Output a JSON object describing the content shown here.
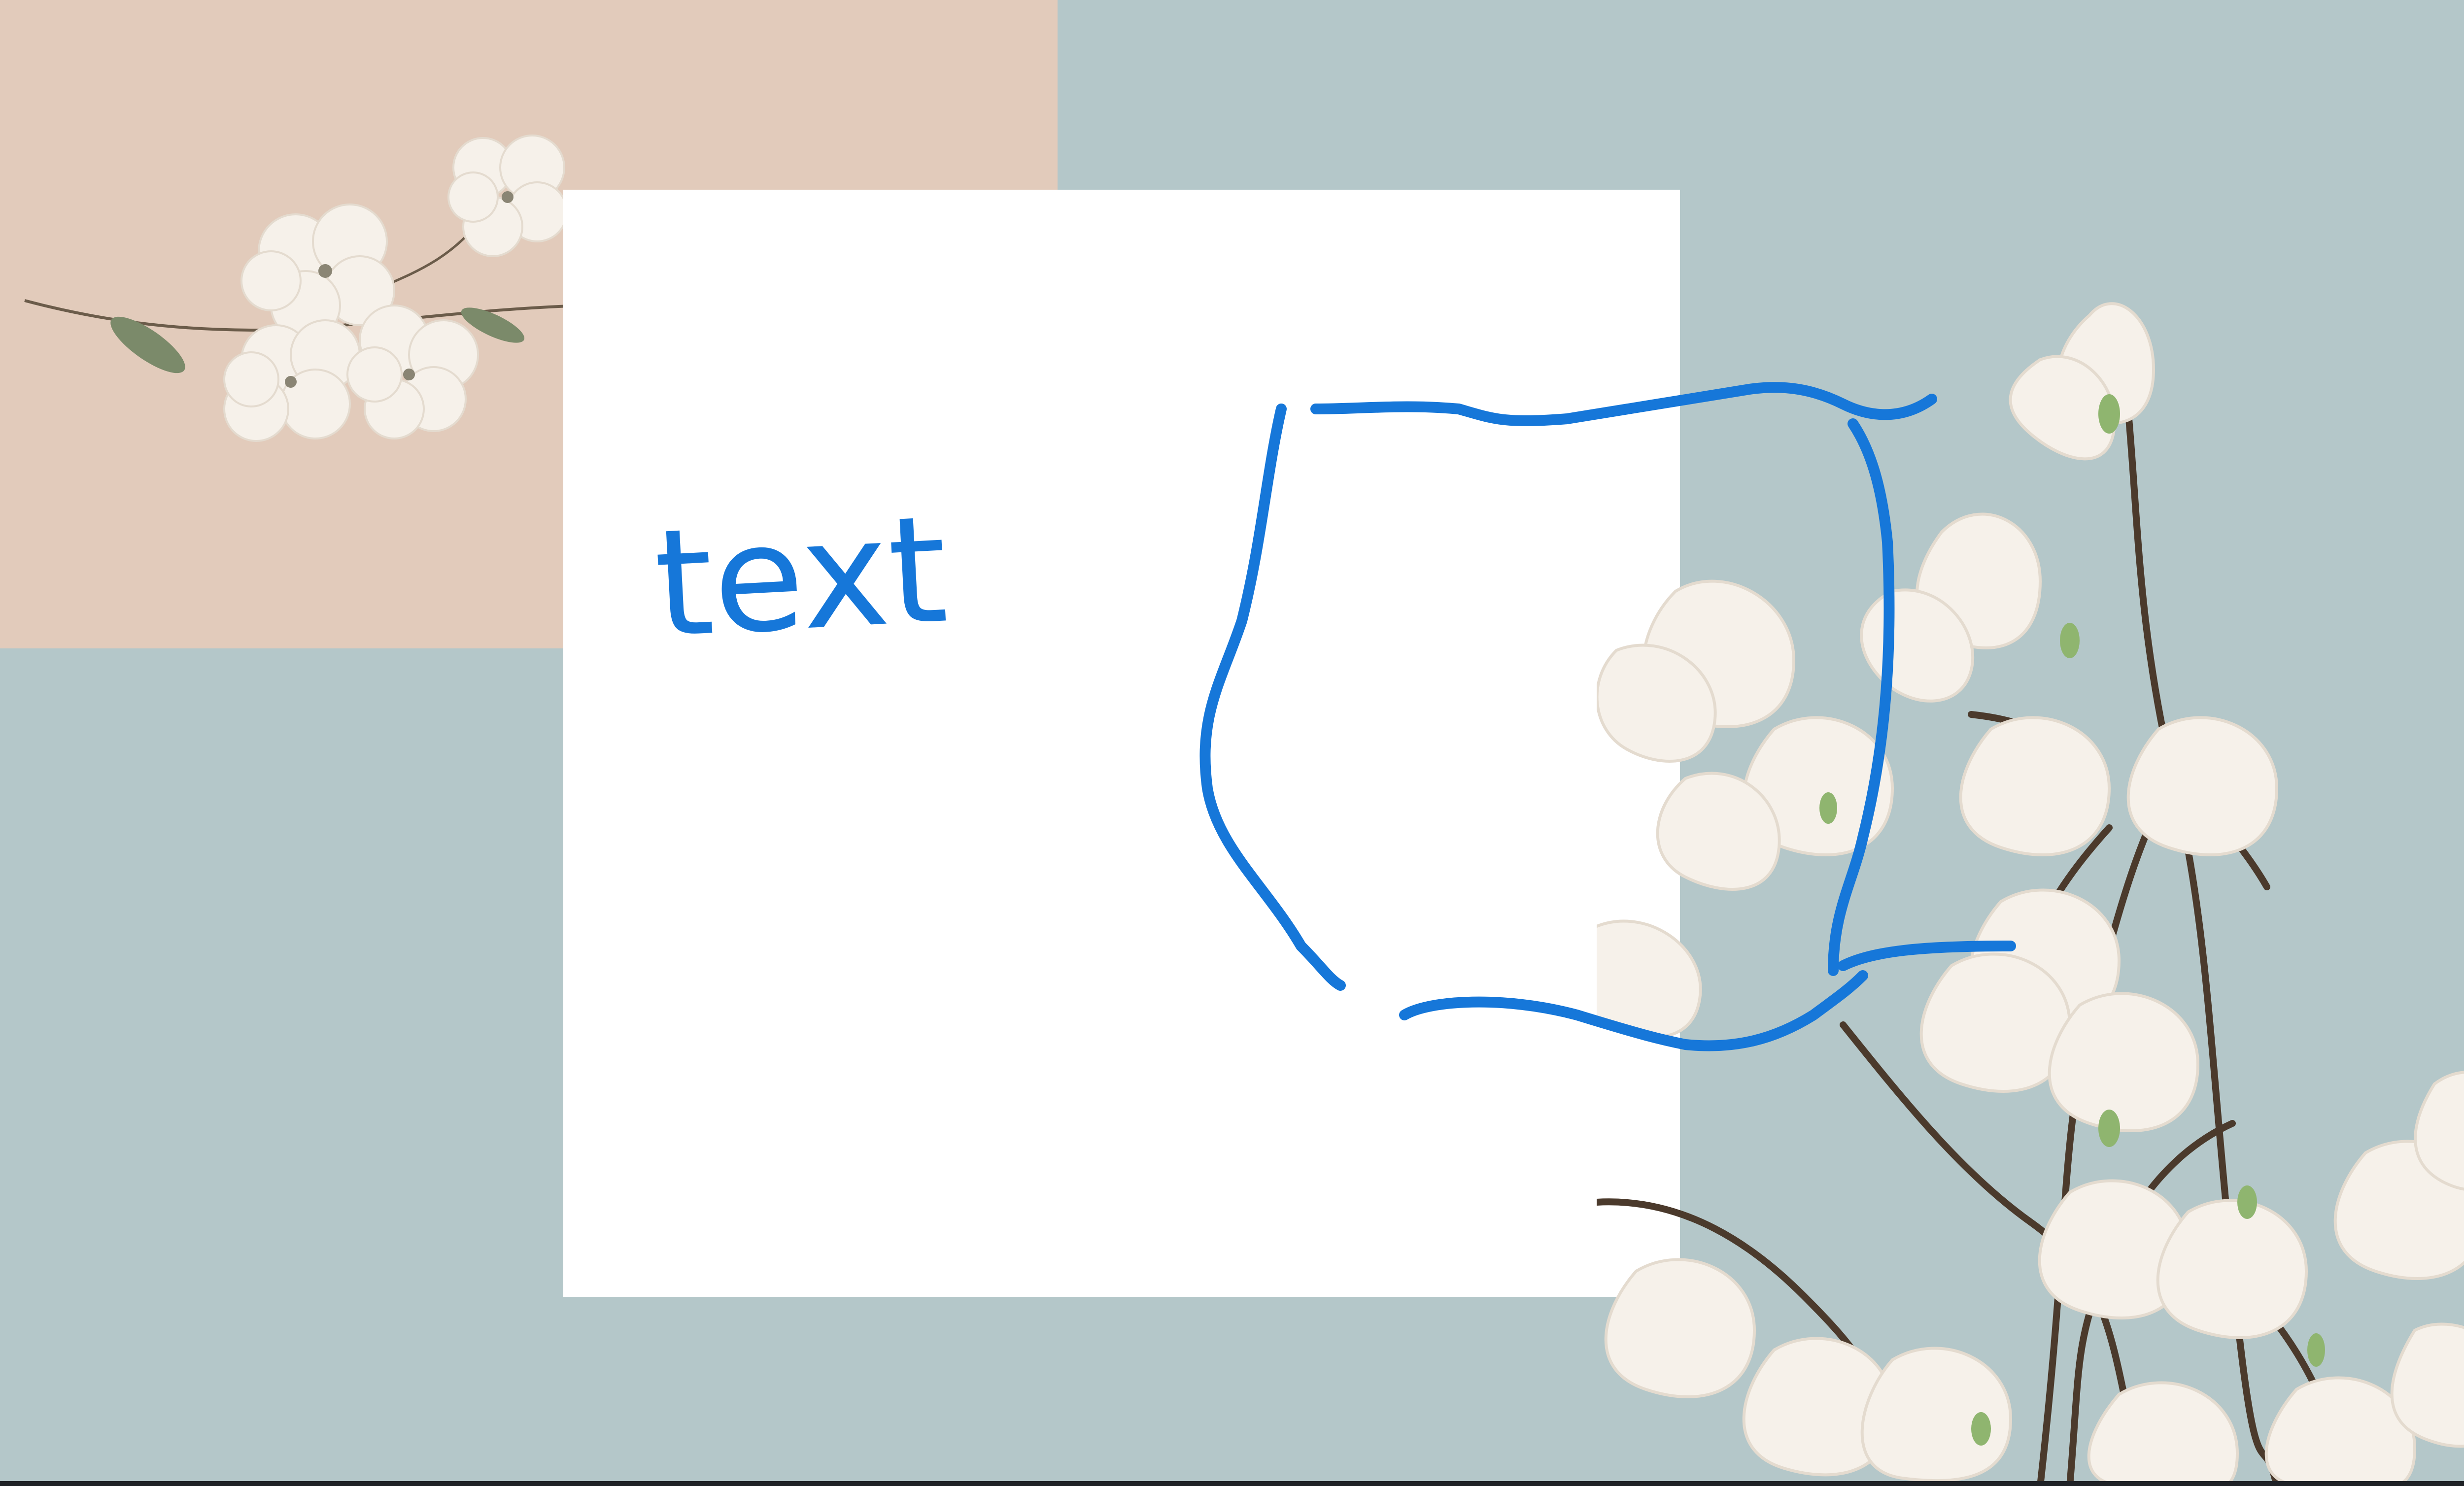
{
  "colors": {
    "background_blue": "#b4c7c9",
    "background_peach": "#e2cbbb",
    "card": "#ffffff",
    "ink": "#1677d9",
    "petal": "#f6f1ea",
    "petal_shade": "#e4dbcf",
    "branch": "#4b3a2c",
    "leaf": "#7b8a6a",
    "bud": "#8fb56f"
  },
  "handwriting": {
    "word": "text"
  },
  "icons": {
    "flower_top_left": "white-blossom-branch-icon",
    "flower_right": "magnolia-branch-icon"
  }
}
